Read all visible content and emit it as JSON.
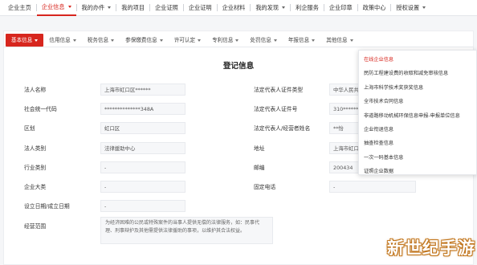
{
  "topnav": {
    "items": [
      {
        "label": "企业主页",
        "caret": false
      },
      {
        "label": "企业信息",
        "caret": true,
        "active": true
      },
      {
        "label": "我的办件",
        "caret": true
      },
      {
        "label": "我的项目",
        "caret": false
      },
      {
        "label": "企业证照",
        "caret": false
      },
      {
        "label": "企业证明",
        "caret": false
      },
      {
        "label": "企业材料",
        "caret": false
      },
      {
        "label": "我的发现",
        "caret": true
      },
      {
        "label": "利企服务",
        "caret": false
      },
      {
        "label": "企业印章",
        "caret": false
      },
      {
        "label": "政策中心",
        "caret": false
      },
      {
        "label": "授权设置",
        "caret": true
      }
    ]
  },
  "subtabs": [
    {
      "label": "基本信息",
      "active": true
    },
    {
      "label": "信用信息"
    },
    {
      "label": "税务信息"
    },
    {
      "label": "参保缴费信息"
    },
    {
      "label": "许可认定"
    },
    {
      "label": "专利信息"
    },
    {
      "label": "处罚信息"
    },
    {
      "label": "年报信息"
    },
    {
      "label": "其他信息"
    }
  ],
  "section_title": "登记信息",
  "form": {
    "legal_name_label": "法人名称",
    "legal_name_value": "上海市虹口区******",
    "rep_id_type_label": "法定代表人证件类型",
    "rep_id_type_value": "中华人民共和国居民身份证",
    "credit_code_label": "社会统一代码",
    "credit_code_value": "**************348A",
    "rep_id_no_label": "法定代表人证件号",
    "rep_id_no_value": "310**********",
    "district_label": "区划",
    "district_value": "虹口区",
    "rep_name_label": "法定代表人/经营者姓名",
    "rep_name_value": "**怡",
    "legal_type_label": "法人类别",
    "legal_type_value": "法律援助中心",
    "address_label": "地址",
    "address_value": "上海市虹口区******",
    "industry_label": "行业类别",
    "industry_value": "-",
    "postcode_label": "邮编",
    "postcode_value": "200434",
    "size_label": "企业大类",
    "size_value": "-",
    "phone_label": "固定电话",
    "phone_value": "-",
    "setup_date_label": "设立日期/成立日期",
    "setup_date_value": "-",
    "scope_label": "经营范围",
    "scope_value": "为经济困难的公民或特殊案件的当事人提供无偿的法律服务，如：民事代理、刑事辩护及其他需提供法律援助的事项，以维护其合法权益。"
  },
  "dropdown": {
    "items": [
      "在线企业信息",
      "民防工程建设费的收取和减免审核信息",
      "上海市科学技术奖获奖信息",
      "全市技术合同信息",
      "非道路移动机械环保信息申报-申报单位信息",
      "企业衔退信息",
      "抽查检查信息",
      "一次一码基本信息",
      "证照企业数据"
    ]
  },
  "watermark": "新世纪手游",
  "colors": {
    "accent": "#d7261e",
    "panel": "#ffffff",
    "field_bg": "#f6f7f9"
  }
}
